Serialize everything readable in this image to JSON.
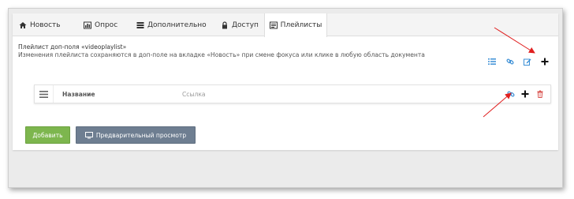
{
  "tabs": [
    {
      "label": "Новость",
      "icon": "home-icon"
    },
    {
      "label": "Опрос",
      "icon": "chart-icon"
    },
    {
      "label": "Дополнительно",
      "icon": "list-icon"
    },
    {
      "label": "Доступ",
      "icon": "lock-icon"
    },
    {
      "label": "Плейлисты",
      "icon": "playlist-icon"
    }
  ],
  "active_tab": "Плейлисты",
  "section": {
    "title": "Плейлист доп-поля «videoplaylist»",
    "description": "Изменения плейлиста сохраняются в доп-поле на вкладке «Новость» при смене фокуса или клике в любую область документа"
  },
  "toolbar_icons": [
    "list-icon",
    "link-icon",
    "edit-icon",
    "plus-icon"
  ],
  "row": {
    "name_placeholder": "Название",
    "link_placeholder": "Ссылка",
    "icons": [
      "link-icon",
      "plus-icon",
      "trash-icon"
    ]
  },
  "buttons": {
    "add": "Добавить",
    "preview": "Предварительный просмотр"
  },
  "colors": {
    "accent_blue": "#3b8fd6",
    "add_green": "#7db64e",
    "preview_gray": "#6e7e91",
    "delete_red": "#d9534f",
    "arrow_red": "#e02020"
  }
}
